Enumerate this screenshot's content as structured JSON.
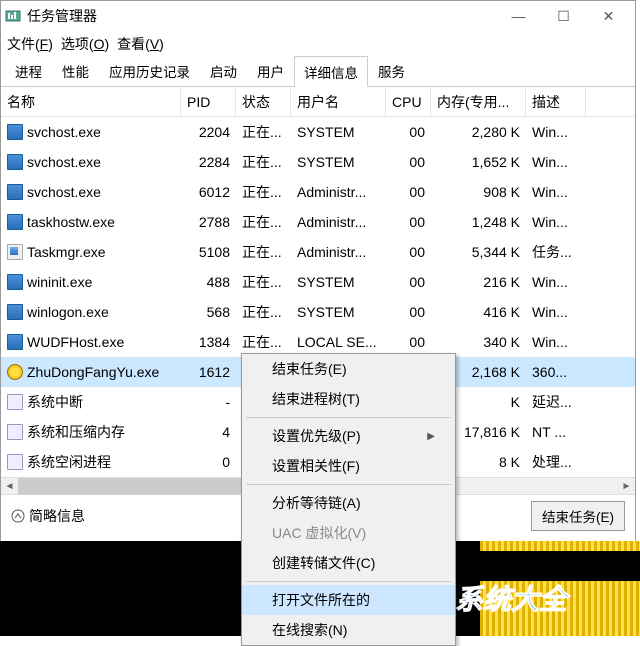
{
  "title": "任务管理器",
  "window_controls": {
    "min": "—",
    "max": "☐",
    "close": "✕"
  },
  "menubar": [
    {
      "label": "文件",
      "key": "F"
    },
    {
      "label": "选项",
      "key": "O"
    },
    {
      "label": "查看",
      "key": "V"
    }
  ],
  "tabs": [
    "进程",
    "性能",
    "应用历史记录",
    "启动",
    "用户",
    "详细信息",
    "服务"
  ],
  "active_tab": 5,
  "columns": [
    "名称",
    "PID",
    "状态",
    "用户名",
    "CPU",
    "内存(专用...",
    "描述"
  ],
  "rows": [
    {
      "icon": "svc",
      "name": "svchost.exe",
      "pid": "2204",
      "status": "正在...",
      "user": "SYSTEM",
      "cpu": "00",
      "mem": "2,280 K",
      "desc": "Win..."
    },
    {
      "icon": "svc",
      "name": "svchost.exe",
      "pid": "2284",
      "status": "正在...",
      "user": "SYSTEM",
      "cpu": "00",
      "mem": "1,652 K",
      "desc": "Win..."
    },
    {
      "icon": "svc",
      "name": "svchost.exe",
      "pid": "6012",
      "status": "正在...",
      "user": "Administr...",
      "cpu": "00",
      "mem": "908 K",
      "desc": "Win..."
    },
    {
      "icon": "svc",
      "name": "taskhostw.exe",
      "pid": "2788",
      "status": "正在...",
      "user": "Administr...",
      "cpu": "00",
      "mem": "1,248 K",
      "desc": "Win..."
    },
    {
      "icon": "gen",
      "name": "Taskmgr.exe",
      "pid": "5108",
      "status": "正在...",
      "user": "Administr...",
      "cpu": "00",
      "mem": "5,344 K",
      "desc": "任务..."
    },
    {
      "icon": "svc",
      "name": "wininit.exe",
      "pid": "488",
      "status": "正在...",
      "user": "SYSTEM",
      "cpu": "00",
      "mem": "216 K",
      "desc": "Win..."
    },
    {
      "icon": "svc",
      "name": "winlogon.exe",
      "pid": "568",
      "status": "正在...",
      "user": "SYSTEM",
      "cpu": "00",
      "mem": "416 K",
      "desc": "Win..."
    },
    {
      "icon": "svc",
      "name": "WUDFHost.exe",
      "pid": "1384",
      "status": "正在...",
      "user": "LOCAL SE...",
      "cpu": "00",
      "mem": "340 K",
      "desc": "Win..."
    },
    {
      "icon": "yellow",
      "name": "ZhuDongFangYu.exe",
      "pid": "1612",
      "status": "",
      "user": "",
      "cpu": "",
      "mem": "2,168 K",
      "desc": "360...",
      "selected": true
    },
    {
      "icon": "sys",
      "name": "系统中断",
      "pid": "-",
      "status": "",
      "user": "",
      "cpu": "",
      "mem": "K",
      "desc": "延迟..."
    },
    {
      "icon": "sys",
      "name": "系统和压缩内存",
      "pid": "4",
      "status": "",
      "user": "",
      "cpu": "",
      "mem": "17,816 K",
      "desc": "NT ..."
    },
    {
      "icon": "sys",
      "name": "系统空闲进程",
      "pid": "0",
      "status": "",
      "user": "",
      "cpu": "",
      "mem": "8 K",
      "desc": "处理..."
    }
  ],
  "context_menu": [
    {
      "label": "结束任务(E)",
      "type": "item"
    },
    {
      "label": "结束进程树(T)",
      "type": "item"
    },
    {
      "type": "sep"
    },
    {
      "label": "设置优先级(P)",
      "type": "submenu"
    },
    {
      "label": "设置相关性(F)",
      "type": "item"
    },
    {
      "type": "sep"
    },
    {
      "label": "分析等待链(A)",
      "type": "item"
    },
    {
      "label": "UAC 虚拟化(V)",
      "type": "item",
      "disabled": true
    },
    {
      "label": "创建转储文件(C)",
      "type": "item"
    },
    {
      "type": "sep"
    },
    {
      "label": "打开文件所在的",
      "type": "item",
      "highlight": true
    },
    {
      "label": "在线搜索(N)",
      "type": "item"
    }
  ],
  "footer": {
    "expand": "简略信息",
    "button": "结束任务(E)"
  },
  "brand": "系统大全"
}
